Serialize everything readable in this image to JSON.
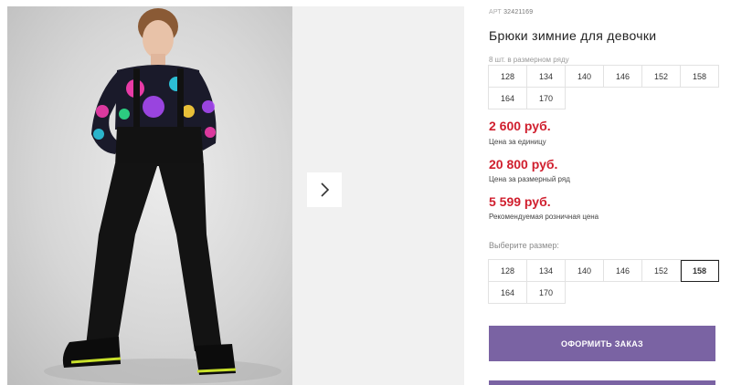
{
  "product": {
    "article_label": "АРТ",
    "article_value": "32421169",
    "title": "Брюки зимние для девочки",
    "pack_note": "8 шт. в размерном ряду",
    "pack_sizes": [
      "128",
      "134",
      "140",
      "146",
      "152",
      "158",
      "164",
      "170"
    ]
  },
  "prices": {
    "unit_price": "2 600 руб.",
    "unit_label": "Цена за единицу",
    "pack_price": "20 800 руб.",
    "pack_label": "Цена за размерный ряд",
    "retail_price": "5 599 руб.",
    "retail_label": "Рекомендуемая розничная цена"
  },
  "size_select": {
    "label": "Выберите размер:",
    "sizes": [
      "128",
      "134",
      "140",
      "146",
      "152",
      "158",
      "164",
      "170"
    ],
    "selected": "158"
  },
  "order_button": "ОФОРМИТЬ ЗАКАЗ",
  "colors": {
    "price": "#d01f2e",
    "button": "#7a63a3"
  },
  "icons": {
    "next": "chevron-right-icon"
  }
}
